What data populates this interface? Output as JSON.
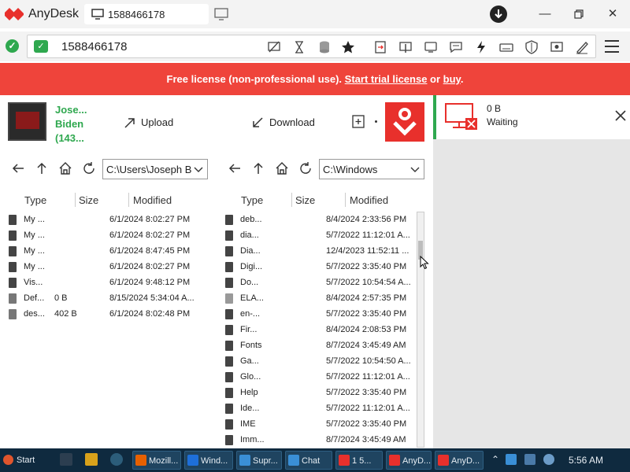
{
  "app": {
    "title": "AnyDesk",
    "tab_label": "1588466178"
  },
  "address": {
    "value": "1588466178"
  },
  "banner": {
    "prefix": "Free license (non-professional use). ",
    "trial_link": "Start trial license",
    "middle": " or ",
    "buy_link": "buy",
    "suffix": "."
  },
  "local": {
    "user_name": "Jose... Biden (143...",
    "upload_label": "Upload",
    "path": "C:\\Users\\Joseph B",
    "columns": {
      "type": "Type",
      "size": "Size",
      "modified": "Modified"
    },
    "files": [
      {
        "name": "My ...",
        "size": "",
        "modified": "6/1/2024 8:02:27 PM",
        "icon": "folder"
      },
      {
        "name": "My ...",
        "size": "",
        "modified": "6/1/2024 8:02:27 PM",
        "icon": "folder"
      },
      {
        "name": "My ...",
        "size": "",
        "modified": "6/1/2024 8:47:45 PM",
        "icon": "folder"
      },
      {
        "name": "My ...",
        "size": "",
        "modified": "6/1/2024 8:02:27 PM",
        "icon": "folder"
      },
      {
        "name": "Vis...",
        "size": "",
        "modified": "6/1/2024 9:48:12 PM",
        "icon": "folder"
      },
      {
        "name": "Def...",
        "size": "0 B",
        "modified": "8/15/2024 5:34:04 A...",
        "icon": "file"
      },
      {
        "name": "des...",
        "size": "402 B",
        "modified": "6/1/2024 8:02:48 PM",
        "icon": "doc"
      }
    ]
  },
  "remote": {
    "download_label": "Download",
    "path": "C:\\Windows",
    "columns": {
      "type": "Type",
      "size": "Size",
      "modified": "Modified"
    },
    "files": [
      {
        "name": "deb...",
        "modified": "8/4/2024 2:33:56 PM",
        "icon": "folder"
      },
      {
        "name": "dia...",
        "modified": "5/7/2022 11:12:01 A...",
        "icon": "folder"
      },
      {
        "name": "Dia...",
        "modified": "12/4/2023 11:52:11 ...",
        "icon": "folder"
      },
      {
        "name": "Digi...",
        "modified": "5/7/2022 3:35:40 PM",
        "icon": "folder"
      },
      {
        "name": "Do...",
        "modified": "5/7/2022 10:54:54 A...",
        "icon": "folder"
      },
      {
        "name": "ELA...",
        "modified": "8/4/2024 2:57:35 PM",
        "icon": "folder-light"
      },
      {
        "name": "en-...",
        "modified": "5/7/2022 3:35:40 PM",
        "icon": "folder"
      },
      {
        "name": "Fir...",
        "modified": "8/4/2024 2:08:53 PM",
        "icon": "folder"
      },
      {
        "name": "Fonts",
        "modified": "8/7/2024 3:45:49 AM",
        "icon": "folder"
      },
      {
        "name": "Ga...",
        "modified": "5/7/2022 10:54:50 A...",
        "icon": "folder"
      },
      {
        "name": "Glo...",
        "modified": "5/7/2022 11:12:01 A...",
        "icon": "folder"
      },
      {
        "name": "Help",
        "modified": "5/7/2022 3:35:40 PM",
        "icon": "folder"
      },
      {
        "name": "Ide...",
        "modified": "5/7/2022 11:12:01 A...",
        "icon": "folder"
      },
      {
        "name": "IME",
        "modified": "5/7/2022 3:35:40 PM",
        "icon": "folder"
      },
      {
        "name": "Imm...",
        "modified": "8/7/2024 3:45:49 AM",
        "icon": "folder"
      }
    ]
  },
  "transfer": {
    "size": "0 B",
    "status": "Waiting"
  },
  "taskbar": {
    "start_label": "Start",
    "tasks": [
      {
        "label": "Mozill...",
        "color": "#e66000"
      },
      {
        "label": "Wind...",
        "color": "#1e6fd9"
      },
      {
        "label": "Supr...",
        "color": "#3a8fd6"
      },
      {
        "label": "Chat",
        "color": "#3a8fd6"
      },
      {
        "label": "1 5...",
        "color": "#e8302c"
      },
      {
        "label": "AnyD...",
        "color": "#e8302c"
      },
      {
        "label": "AnyD...",
        "color": "#e8302c"
      }
    ],
    "clock": "5:56 AM"
  },
  "colors": {
    "accent_green": "#2fa84f",
    "brand_red": "#ef443b",
    "taskbar_bg": "#0f2a3f"
  }
}
